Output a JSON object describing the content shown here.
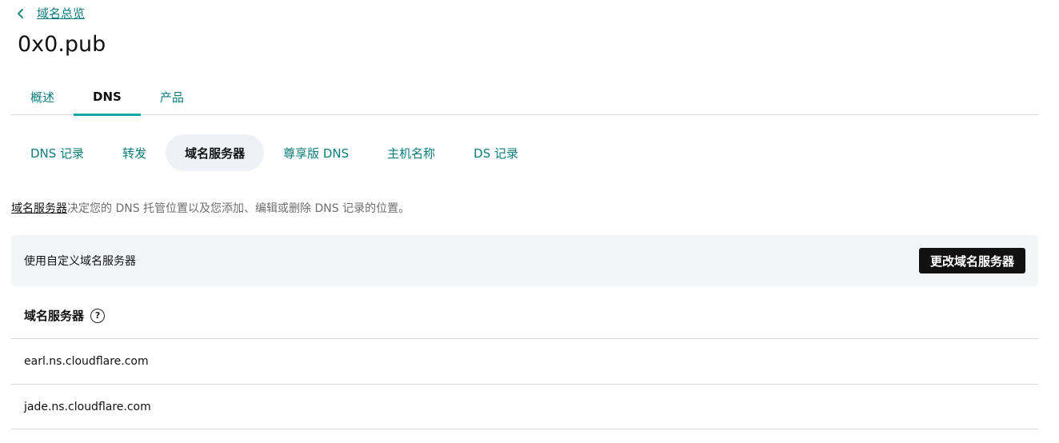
{
  "breadcrumb": {
    "back_label": "域名总览"
  },
  "page": {
    "title": "0x0.pub"
  },
  "main_tabs": [
    {
      "label": "概述",
      "active": false
    },
    {
      "label": "DNS",
      "active": true
    },
    {
      "label": "产品",
      "active": false
    }
  ],
  "sub_tabs": [
    {
      "label": "DNS 记录",
      "active": false
    },
    {
      "label": "转发",
      "active": false
    },
    {
      "label": "域名服务器",
      "active": true
    },
    {
      "label": "尊享版 DNS",
      "active": false
    },
    {
      "label": "主机名称",
      "active": false
    },
    {
      "label": "DS 记录",
      "active": false
    }
  ],
  "description": {
    "link_text": "域名服务器",
    "rest_text": "决定您的 DNS 托管位置以及您添加、编辑或删除 DNS 记录的位置。"
  },
  "custom_ns": {
    "label": "使用自定义域名服务器",
    "button_label": "更改域名服务器"
  },
  "nameservers": {
    "header": "域名服务器",
    "help_icon": "question-circle-icon",
    "items": [
      "earl.ns.cloudflare.com",
      "jade.ns.cloudflare.com"
    ]
  },
  "colors": {
    "accent": "#13a7a2",
    "link": "#0a7b7a",
    "button_bg": "#111111",
    "panel_bg": "#f4f5f7",
    "active_subtab_bg": "#eef2f7"
  }
}
